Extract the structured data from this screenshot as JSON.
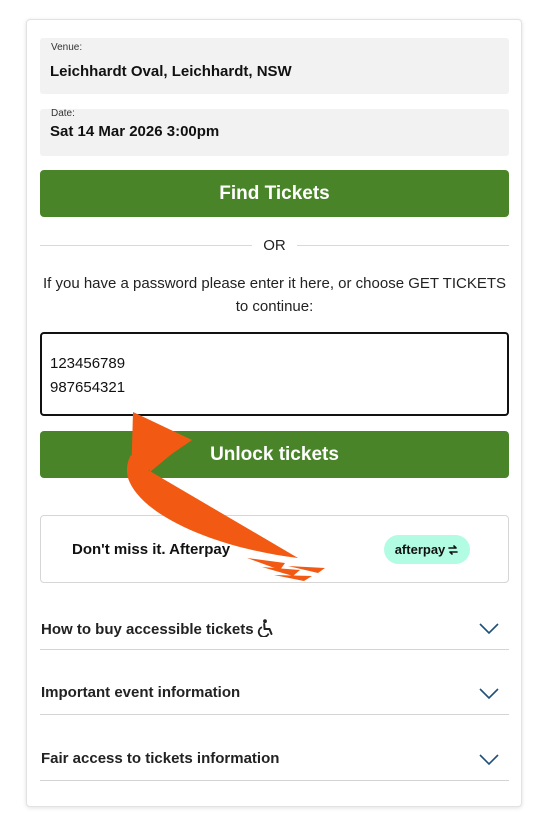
{
  "venue": {
    "label": "Venue:",
    "value": "Leichhardt Oval, Leichhardt, NSW"
  },
  "date": {
    "label": "Date:",
    "value": "Sat 14 Mar 2026 3:00pm"
  },
  "find_button": "Find Tickets",
  "divider_text": "OR",
  "helper_text": "If you have a password please enter it here, or choose GET TICKETS to continue:",
  "password_field": {
    "value": "123456789\n987654321"
  },
  "unlock_button": "Unlock tickets",
  "afterpay": {
    "message": "Don't miss it. Afterpay",
    "badge": "afterpay"
  },
  "accordions": [
    {
      "title": "How to buy accessible tickets"
    },
    {
      "title": "Important event information"
    },
    {
      "title": "Fair access to tickets information"
    }
  ],
  "colors": {
    "primary_button": "#4a8428",
    "annotation_arrow": "#f25a14",
    "afterpay_badge": "#b2fce4"
  },
  "icons": {
    "accessibility": "wheelchair-icon",
    "accordion": "chevron-down-icon",
    "annotation": "curved-arrow-icon"
  }
}
